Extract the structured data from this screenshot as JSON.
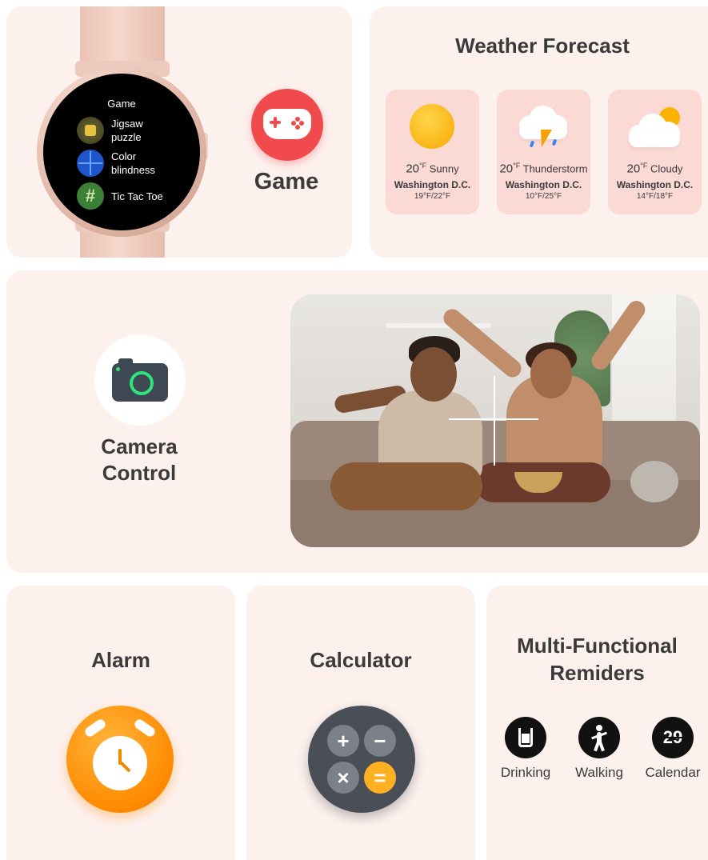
{
  "game_card": {
    "watch": {
      "screen_title": "Game",
      "apps": [
        {
          "name": "Jigsaw\npuzzle",
          "icon": "jigsaw-puzzle-icon"
        },
        {
          "name": "Color\nblindness",
          "icon": "color-blindness-icon"
        },
        {
          "name": "Tic Tac Toe",
          "icon": "tic-tac-toe-icon"
        }
      ]
    },
    "label": "Game",
    "icon": "gamepad-icon",
    "accent": "#f04a4c"
  },
  "weather_card": {
    "title": "Weather Forecast",
    "forecasts": [
      {
        "temp": "20",
        "unit": "°F",
        "condition": "Sunny",
        "city": "Washington D.C.",
        "range": "19°F/22°F",
        "icon": "sun-icon"
      },
      {
        "temp": "20",
        "unit": "°F",
        "condition": "Thunderstorm",
        "city": "Washington D.C.",
        "range": "10°F/25°F",
        "icon": "thunderstorm-icon"
      },
      {
        "temp": "20",
        "unit": "°F",
        "condition": "Cloudy",
        "city": "Washington D.C.",
        "range": "14°F/18°F",
        "icon": "cloudy-icon"
      }
    ]
  },
  "camera_card": {
    "label": "Camera\nControl",
    "icon": "camera-icon",
    "accent": "#2fe27b"
  },
  "alarm_card": {
    "title": "Alarm",
    "icon": "alarm-clock-icon",
    "accent": "#ff8a00"
  },
  "calculator_card": {
    "title": "Calculator",
    "icon": "calculator-icon",
    "buttons": [
      "+",
      "−",
      "×",
      "="
    ],
    "accent": "#ffb020"
  },
  "reminders_card": {
    "title": "Multi-Functional\nRemiders",
    "items": [
      {
        "label": "Drinking",
        "icon": "drinking-cup-icon"
      },
      {
        "label": "Walking",
        "icon": "walking-person-icon"
      },
      {
        "label": "Calendar",
        "icon": "calendar-icon",
        "number": "29"
      }
    ]
  }
}
